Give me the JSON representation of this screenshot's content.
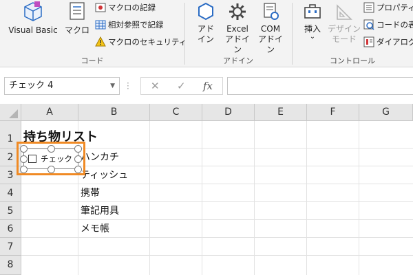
{
  "ribbon": {
    "code_group": {
      "label": "コード",
      "visual_basic": "Visual Basic",
      "macro": "マクロ",
      "record_macro": "マクロの記録",
      "relative_ref": "相対参照で記録",
      "macro_security": "マクロのセキュリティ"
    },
    "addin_group": {
      "label": "アドイン",
      "addin_line1": "アド",
      "addin_line2": "イン",
      "excel_addin_line1": "Excel",
      "excel_addin_line2": "アドイン",
      "com_addin_line1": "COM",
      "com_addin_line2": "アドイン"
    },
    "control_group": {
      "label": "コントロール",
      "insert": "挿入",
      "insert_arrow": "⌄",
      "design_mode_line1": "デザイン",
      "design_mode_line2": "モード",
      "properties": "プロパティ",
      "view_code": "コードの表",
      "dialog": "ダイアログ"
    }
  },
  "formula_bar": {
    "name_box": "チェック 4",
    "cancel": "✕",
    "enter": "✓",
    "fx": "fx",
    "formula": ""
  },
  "sheet": {
    "columns": [
      "A",
      "B",
      "C",
      "D",
      "E",
      "F",
      "G"
    ],
    "rows": [
      "1",
      "2",
      "3",
      "4",
      "5",
      "6",
      "7",
      "8"
    ],
    "cells": {
      "A1": "持ち物リスト",
      "B2": "ハンカチ",
      "B3": "ティッシュ",
      "B4": "携帯",
      "B5": "筆記用具",
      "B6": "メモ帳"
    }
  },
  "checkbox_control": {
    "label": "チェック 4",
    "checked": false
  },
  "colors": {
    "highlight": "#f08a24",
    "ribbon_bg": "#f3f3f3",
    "header_bg": "#e6e6e6",
    "icon_blue": "#2b6cc4"
  }
}
